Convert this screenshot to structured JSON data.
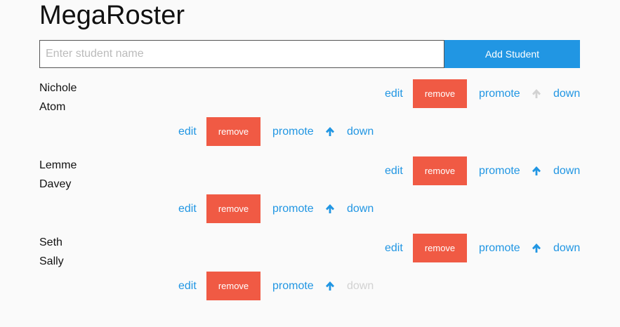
{
  "app": {
    "title": "MegaRoster"
  },
  "add_form": {
    "placeholder": "Enter student name",
    "value": "",
    "button_label": "Add Student"
  },
  "controls": {
    "edit": "edit",
    "remove": "remove",
    "promote": "promote",
    "down": "down"
  },
  "colors": {
    "link": "#2196e3",
    "remove_bg": "#f05a44",
    "disabled": "#d2d2d2",
    "add_bg": "#2196e3"
  },
  "icons": {
    "up": "arrow-up-icon"
  },
  "students": [
    {
      "name": "Nichole",
      "up_enabled": false,
      "down_enabled": true
    },
    {
      "name": "Atom",
      "up_enabled": true,
      "down_enabled": true
    },
    {
      "name": "Lemme",
      "up_enabled": true,
      "down_enabled": true
    },
    {
      "name": "Davey",
      "up_enabled": true,
      "down_enabled": true
    },
    {
      "name": "Seth",
      "up_enabled": true,
      "down_enabled": true
    },
    {
      "name": "Sally",
      "up_enabled": true,
      "down_enabled": false
    }
  ]
}
